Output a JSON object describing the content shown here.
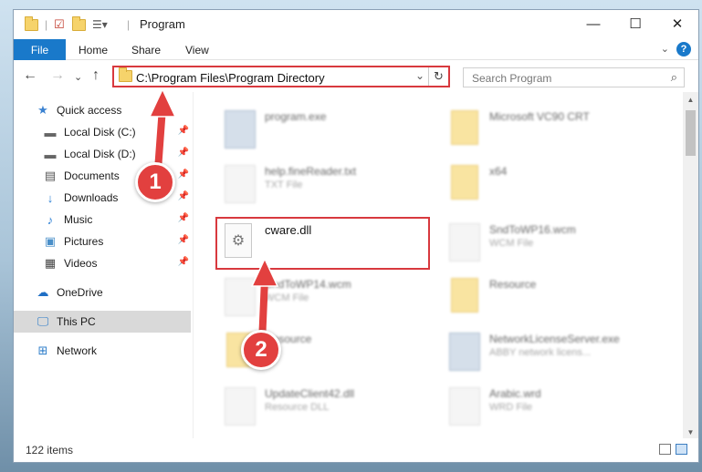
{
  "window": {
    "title": "Program",
    "controls": {
      "minimize": "—",
      "maximize": "☐",
      "close": "✕"
    }
  },
  "ribbon": {
    "tabs": [
      "File",
      "Home",
      "Share",
      "View"
    ],
    "help": "?"
  },
  "address": {
    "path": "C:\\Program Files\\Program Directory",
    "search_placeholder": "Search Program"
  },
  "sidebar": {
    "items": [
      {
        "label": "Quick access",
        "icon": "star-icon"
      },
      {
        "label": "Local Disk (C:)",
        "icon": "drive-icon",
        "pinned": true
      },
      {
        "label": "Local Disk (D:)",
        "icon": "drive-icon",
        "pinned": true
      },
      {
        "label": "Documents",
        "icon": "documents-icon",
        "pinned": true
      },
      {
        "label": "Downloads",
        "icon": "download-icon",
        "pinned": true
      },
      {
        "label": "Music",
        "icon": "music-icon",
        "pinned": true
      },
      {
        "label": "Pictures",
        "icon": "pictures-icon",
        "pinned": true
      },
      {
        "label": "Videos",
        "icon": "videos-icon",
        "pinned": true
      },
      {
        "label": "OneDrive",
        "icon": "cloud-icon"
      },
      {
        "label": "This PC",
        "icon": "computer-icon",
        "selected": true
      },
      {
        "label": "Network",
        "icon": "network-icon"
      }
    ]
  },
  "files": [
    {
      "name": "program.exe",
      "type": "",
      "icon": "app-icon"
    },
    {
      "name": "Microsoft VC90 CRT",
      "type": "",
      "icon": "folder-icon"
    },
    {
      "name": "help.fineReader.txt",
      "type": "TXT File",
      "icon": "text-file-icon"
    },
    {
      "name": "x64",
      "type": "",
      "icon": "folder-icon"
    },
    {
      "name": "cware.dll",
      "type": "",
      "icon": "dll-icon"
    },
    {
      "name": "SndToWP16.wcm",
      "type": "WCM File",
      "icon": "file-icon"
    },
    {
      "name": "SndToWP14.wcm",
      "type": "WCM File",
      "icon": "file-icon"
    },
    {
      "name": "Resource",
      "type": "",
      "icon": "folder-icon"
    },
    {
      "name": "Resource",
      "type": "",
      "icon": "folder-icon"
    },
    {
      "name": "NetworkLicenseServer.exe",
      "type": "ABBY network licens...",
      "icon": "app-icon"
    },
    {
      "name": "UpdateClient42.dll",
      "type": "Resource DLL",
      "icon": "dll-icon"
    },
    {
      "name": "Arabic.wrd",
      "type": "WRD File",
      "icon": "file-icon"
    }
  ],
  "status": {
    "items_count": "122 items"
  },
  "callouts": [
    "1",
    "2"
  ],
  "colors": {
    "accent": "#1979ca",
    "highlight": "#d8393e",
    "selected": "#d9d9d9"
  }
}
